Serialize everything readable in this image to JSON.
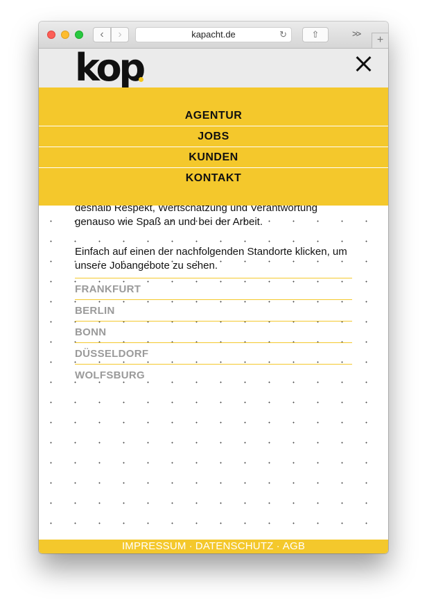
{
  "browser": {
    "url": "kapacht.de",
    "back_icon": "‹",
    "forward_icon": "›",
    "reload_icon": "↻",
    "share_icon": "⇧",
    "overflow_icon": ">>",
    "new_tab_icon": "+"
  },
  "header": {
    "logo": "kop",
    "close_icon": "close-icon"
  },
  "menu": {
    "items": [
      "AGENTUR",
      "JOBS",
      "KUNDEN",
      "KONTAKT"
    ]
  },
  "main": {
    "paragraph1": "deshalb Respekt, Wertschätzung und Verantwortung genauso wie Spaß an und bei der Arbeit.",
    "paragraph2": "Einfach auf einen der nachfolgenden Standorte klicken, um unsere Jobangebote zu sehen.",
    "locations": [
      "FRANKFURT",
      "BERLIN",
      "BONN",
      "DÜSSELDORF",
      "WOLFSBURG"
    ]
  },
  "footer": {
    "links": [
      "IMPRESSUM",
      "DATENSCHUTZ",
      "AGB"
    ],
    "separator": "·"
  },
  "colors": {
    "accent": "#f4c82c",
    "header_bg": "#ebebeb",
    "location_text": "#9a9a9a"
  }
}
